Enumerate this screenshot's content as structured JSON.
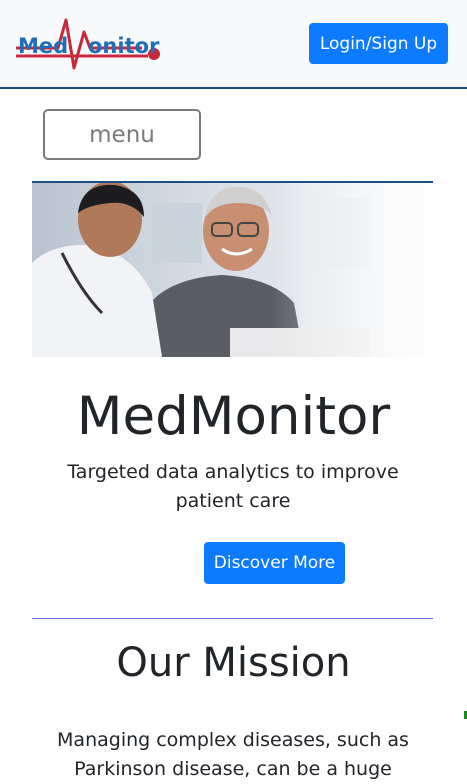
{
  "header": {
    "logo_left": "Med",
    "logo_right": "onitor",
    "login_label": "Login/Sign Up"
  },
  "nav": {
    "menu_label": "menu"
  },
  "hero": {
    "image_icon": "doctor-patient-photo"
  },
  "intro": {
    "title": "MedMonitor",
    "tagline": "Targeted data analytics to improve patient care",
    "cta_label": "Discover More"
  },
  "mission": {
    "title": "Our Mission",
    "text": "Managing complex diseases, such as Parkinson disease, can be a huge"
  },
  "colors": {
    "primary": "#0d7bff",
    "brand_blue": "#1f6fb8",
    "brand_red": "#c8293a",
    "header_border": "#1d4f86"
  }
}
